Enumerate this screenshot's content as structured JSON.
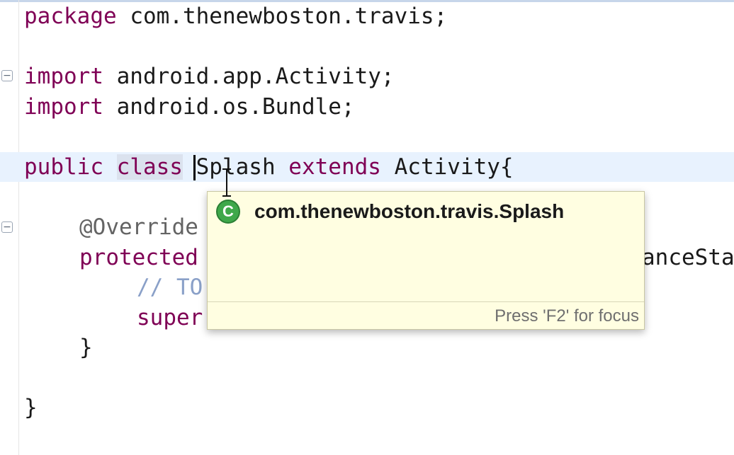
{
  "editor": {
    "lines": [
      {
        "id": "l1",
        "tokens": [
          "package",
          " com.thenewboston.travis;"
        ]
      },
      {
        "id": "l3",
        "tokens": [
          "import",
          " android.app.Activity;"
        ]
      },
      {
        "id": "l4",
        "tokens": [
          "import",
          " android.os.Bundle;"
        ]
      },
      {
        "id": "l6",
        "tokens": [
          "public",
          " ",
          "class",
          " Splash ",
          "extends",
          " Activity{"
        ]
      },
      {
        "id": "l8",
        "tokens": [
          "@Override"
        ]
      },
      {
        "id": "l9",
        "tokens": [
          "protected",
          "anceSta"
        ]
      },
      {
        "id": "l10",
        "tokens": [
          "// TO"
        ]
      },
      {
        "id": "l11",
        "tokens": [
          "super"
        ]
      },
      {
        "id": "l12",
        "tokens": [
          "}"
        ]
      },
      {
        "id": "l14",
        "tokens": [
          "}"
        ]
      }
    ],
    "fold_symbol": "−"
  },
  "popup": {
    "icon_letter": "C",
    "icon_name": "class-icon",
    "title": "com.thenewboston.travis.Splash",
    "hint": "Press 'F2' for focus"
  },
  "colors": {
    "keyword": "#7f0055",
    "annotation": "#646464",
    "comment": "#8aa0c8",
    "popup_bg": "#fffee1",
    "class_icon": "#3fa84a"
  }
}
